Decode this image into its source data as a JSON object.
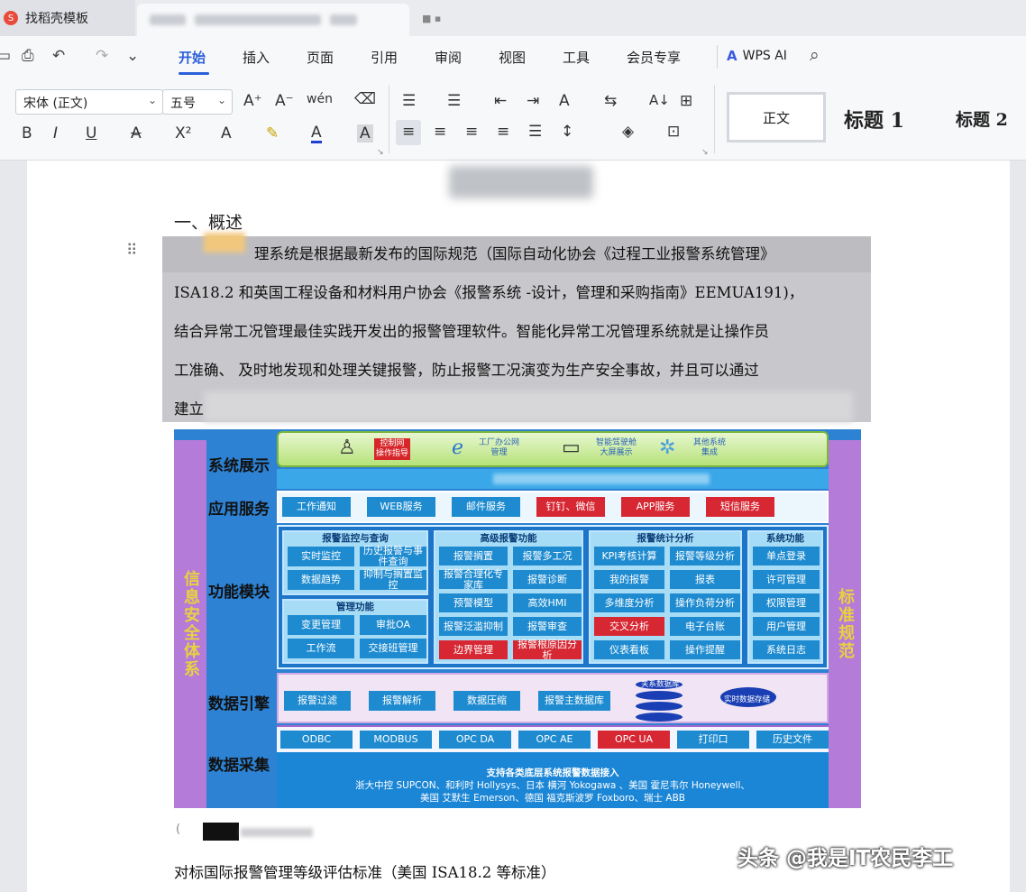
{
  "titlebar": {
    "app_tab": "找稻壳模板",
    "app_logo": "S",
    "extra_icons": "■ ▪"
  },
  "quick_access": {
    "icons": [
      "file-icon",
      "print-preview-icon",
      "undo-icon",
      "redo-icon",
      "more-icon"
    ],
    "glyphs": [
      "▭",
      "⎙",
      "↶",
      "↷",
      "⌄"
    ]
  },
  "menu": {
    "items": [
      "开始",
      "插入",
      "页面",
      "引用",
      "审阅",
      "视图",
      "工具",
      "会员专享"
    ],
    "active": "开始",
    "ai_label": "WPS AI",
    "ai_logo": "A"
  },
  "ribbon": {
    "font_name": "宋体 (正文)",
    "font_size": "五号",
    "glyphs": {
      "grow": "A⁺",
      "shrink": "A⁻",
      "phonetic": "wén",
      "clear": "⌫",
      "bold": "B",
      "italic": "I",
      "underline": "U",
      "strike": "A",
      "superscript": "X²",
      "text_effect": "A",
      "highlight": "✎",
      "font_color": "A",
      "char_shade": "A",
      "bullets": "☰",
      "numbering": "☰",
      "outdent": "⇤",
      "indent": "⇥",
      "wen": "A",
      "direction": "⇆",
      "sort": "A↓",
      "grid": "⊞",
      "align_left": "≡",
      "align_center": "≡",
      "align_right": "≡",
      "justify": "≡",
      "distribute": "☰",
      "line_spacing": "↕",
      "shading": "◈",
      "border": "⊡",
      "dropdown": "⌄"
    },
    "styles": {
      "normal": "正文",
      "h1": "标题 1",
      "h2": "标题 2"
    }
  },
  "document": {
    "heading": "一、概述",
    "lines": [
      "理系统是根据最新发布的国际规范（国际自动化协会《过程工业报警系统管理》",
      "ISA18.2 和英国工程设备和材料用户协会《报警系统 -设计，管理和采购指南》EEMUA191)，",
      "结合异常工况管理最佳实践开发出的报警管理软件。智能化异常工况管理系统就是让操作员",
      "工准确、 及时地发现和处理关键报警，防止报警工况演变为生产安全事故，并且可以通过",
      "建立"
    ],
    "footer": "对标国际报警管理等级评估标准（美国 ISA18.2 等标准）",
    "caption_prefix": "(",
    "watermark": "头条 @我是IT农民李工"
  },
  "diagram": {
    "left_band": "信息安全体系",
    "right_band": "标准规范",
    "layers": [
      "系统展示",
      "应用服务",
      "功能模块",
      "数据引擎",
      "数据采集"
    ],
    "show": {
      "ops": "控制网\n操作指导",
      "office": "工厂办公网\n管理",
      "screen": "智能驾驶舱\n大屏展示",
      "other": "其他系统\n集成"
    },
    "app_services": [
      {
        "label": "工作通知",
        "red": false
      },
      {
        "label": "WEB服务",
        "red": false
      },
      {
        "label": "邮件服务",
        "red": false
      },
      {
        "label": "钉钉、微信",
        "red": true
      },
      {
        "label": "APP服务",
        "red": true
      },
      {
        "label": "短信服务",
        "red": true
      }
    ],
    "groups": {
      "monitor": {
        "title": "报警监控与查询",
        "items": [
          "实时监控",
          "历史报警与事件查询",
          "数据趋势",
          "抑制与搁置监控"
        ]
      },
      "manage": {
        "title": "管理功能",
        "items": [
          "变更管理",
          "审批OA",
          "工作流",
          "交接班管理"
        ]
      },
      "advanced": {
        "title": "高级报警功能",
        "items": [
          "报警搁置",
          "报警多工况",
          "报警合理化专家库",
          "报警诊断",
          "预警模型",
          "高效HMI",
          "报警泛滥抑制",
          "报警审查",
          "边界管理",
          "报警根原因分析"
        ]
      },
      "stats": {
        "title": "报警统计分析",
        "items": [
          "KPI考核计算",
          "报警等级分析",
          "我的报警",
          "报表",
          "多维度分析",
          "操作负荷分析",
          "交叉分析",
          "电子台账",
          "仪表看板",
          "操作提醒"
        ]
      },
      "system": {
        "title": "系统功能",
        "items": [
          "单点登录",
          "许可管理",
          "权限管理",
          "用户管理",
          "系统日志"
        ]
      }
    },
    "engine": [
      "报警过滤",
      "报警解析",
      "数据压缩",
      "报警主数据库"
    ],
    "db_labels": {
      "relational": "关系数据库",
      "realtime": "实时数据存储"
    },
    "collect": [
      {
        "label": "ODBC",
        "red": false
      },
      {
        "label": "MODBUS",
        "red": false
      },
      {
        "label": "OPC DA",
        "red": false
      },
      {
        "label": "OPC AE",
        "red": false
      },
      {
        "label": "OPC UA",
        "red": true
      },
      {
        "label": "打印口",
        "red": false
      },
      {
        "label": "历史文件",
        "red": false
      }
    ],
    "collect_text": [
      "支持各类底层系统报警数据接入",
      "浙大中控 SUPCON、和利时 Hollysys、日本 横河 Yokogawa 、美国 霍尼韦尔 Honeywell、",
      "美国 艾默生 Emerson、德国 福克斯波罗 Foxboro、瑞士 ABB"
    ]
  }
}
